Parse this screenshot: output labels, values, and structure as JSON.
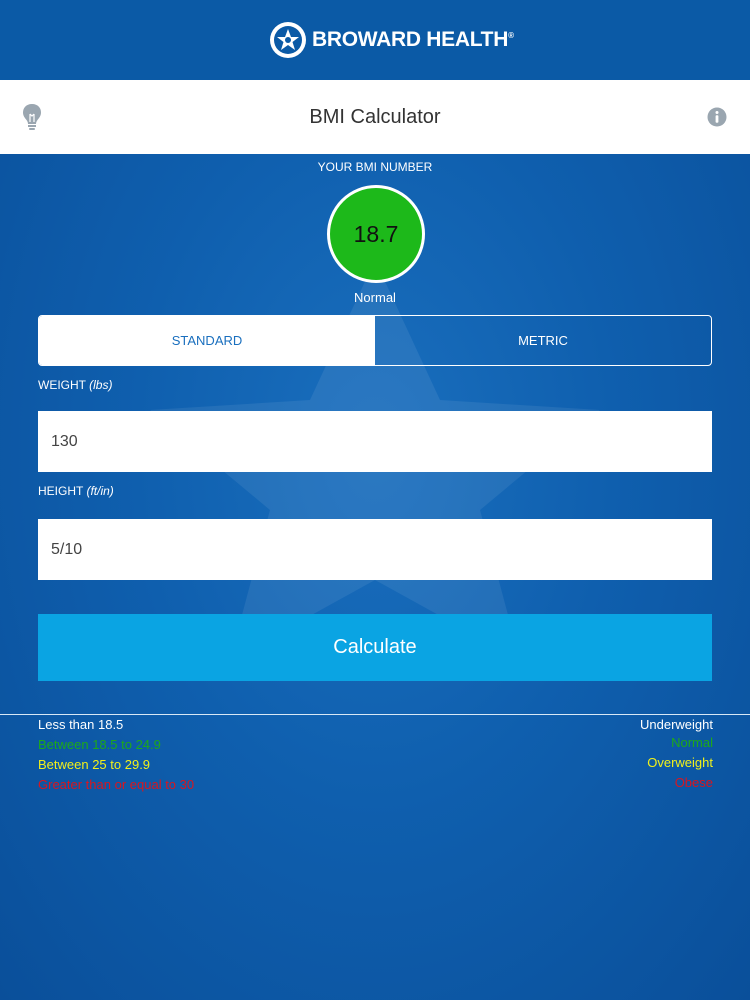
{
  "brand": {
    "name": "BROWARD HEALTH",
    "mark": "®"
  },
  "header": {
    "title": "BMI Calculator",
    "left_icon": "lightbulb-icon",
    "right_icon": "info-icon"
  },
  "result": {
    "label": "YOUR BMI NUMBER",
    "value": "18.7",
    "status": "Normal",
    "status_color": "#1db91a"
  },
  "units": {
    "tabs": [
      "STANDARD",
      "METRIC"
    ],
    "selected": "STANDARD"
  },
  "weight": {
    "label": "WEIGHT",
    "unit": "(lbs)",
    "value": "130"
  },
  "height": {
    "label": "HEIGHT",
    "unit": "(ft/in)",
    "value": "5/10"
  },
  "calculate_label": "Calculate",
  "legend": [
    {
      "range": "Less than 18.5",
      "category": "Underweight",
      "color": "#ffffff"
    },
    {
      "range": "Between 18.5 to 24.9",
      "category": "Normal",
      "color": "#1ea81a"
    },
    {
      "range": "Between 25 to 29.9",
      "category": "Overweight",
      "color": "#f1f11b"
    },
    {
      "range": "Greater than or equal to 30",
      "category": "Obese",
      "color": "#d8161f"
    }
  ]
}
